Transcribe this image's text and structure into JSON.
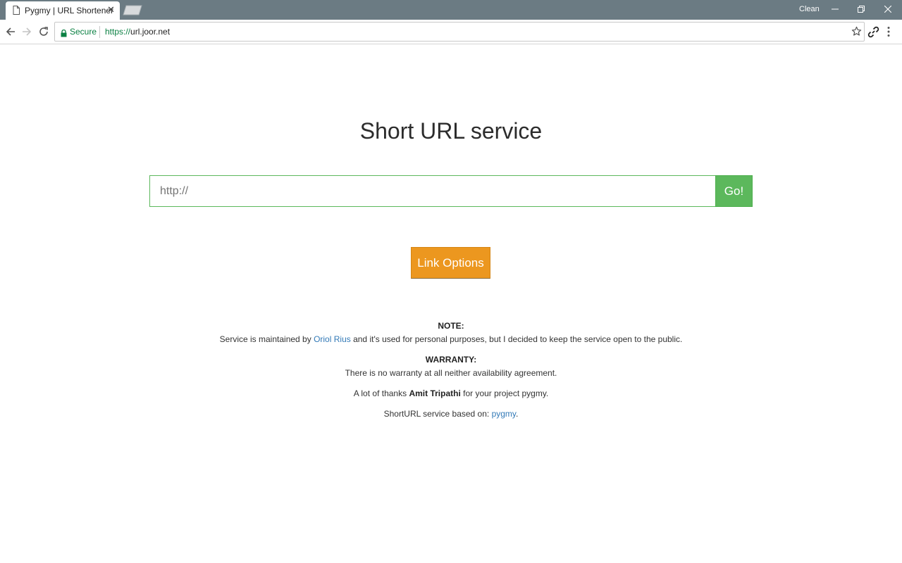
{
  "browser": {
    "tab_title": "Pygmy | URL Shortener",
    "tab_close": "✕",
    "profile_label": "Clean",
    "secure_label": "Secure",
    "url_scheme": "https://",
    "url_host": "url.joor.net"
  },
  "page": {
    "title": "Short URL service",
    "url_input_placeholder": "http://",
    "go_button_label": "Go!",
    "link_options_label": "Link Options"
  },
  "info": {
    "note_heading": "NOTE:",
    "note_text_before": "Service is maintained by ",
    "note_link": "Oriol Rius",
    "note_text_after": " and it's used for personal purposes, but I decided to keep the service open to the public.",
    "warranty_heading": "WARRANTY:",
    "warranty_text": "There is no warranty at all neither availability agreement.",
    "thanks_before": "A lot of thanks ",
    "thanks_name": "Amit Tripathi",
    "thanks_after": " for your project pygmy.",
    "based_on_text": "ShortURL service based on: ",
    "based_on_link": "pygmy",
    "based_on_end": "."
  },
  "colors": {
    "titlebar": "#6b7b83",
    "go_green": "#5cb85c",
    "options_orange": "#ec971f",
    "link_blue": "#337ab7",
    "secure_green": "#0b8043"
  }
}
